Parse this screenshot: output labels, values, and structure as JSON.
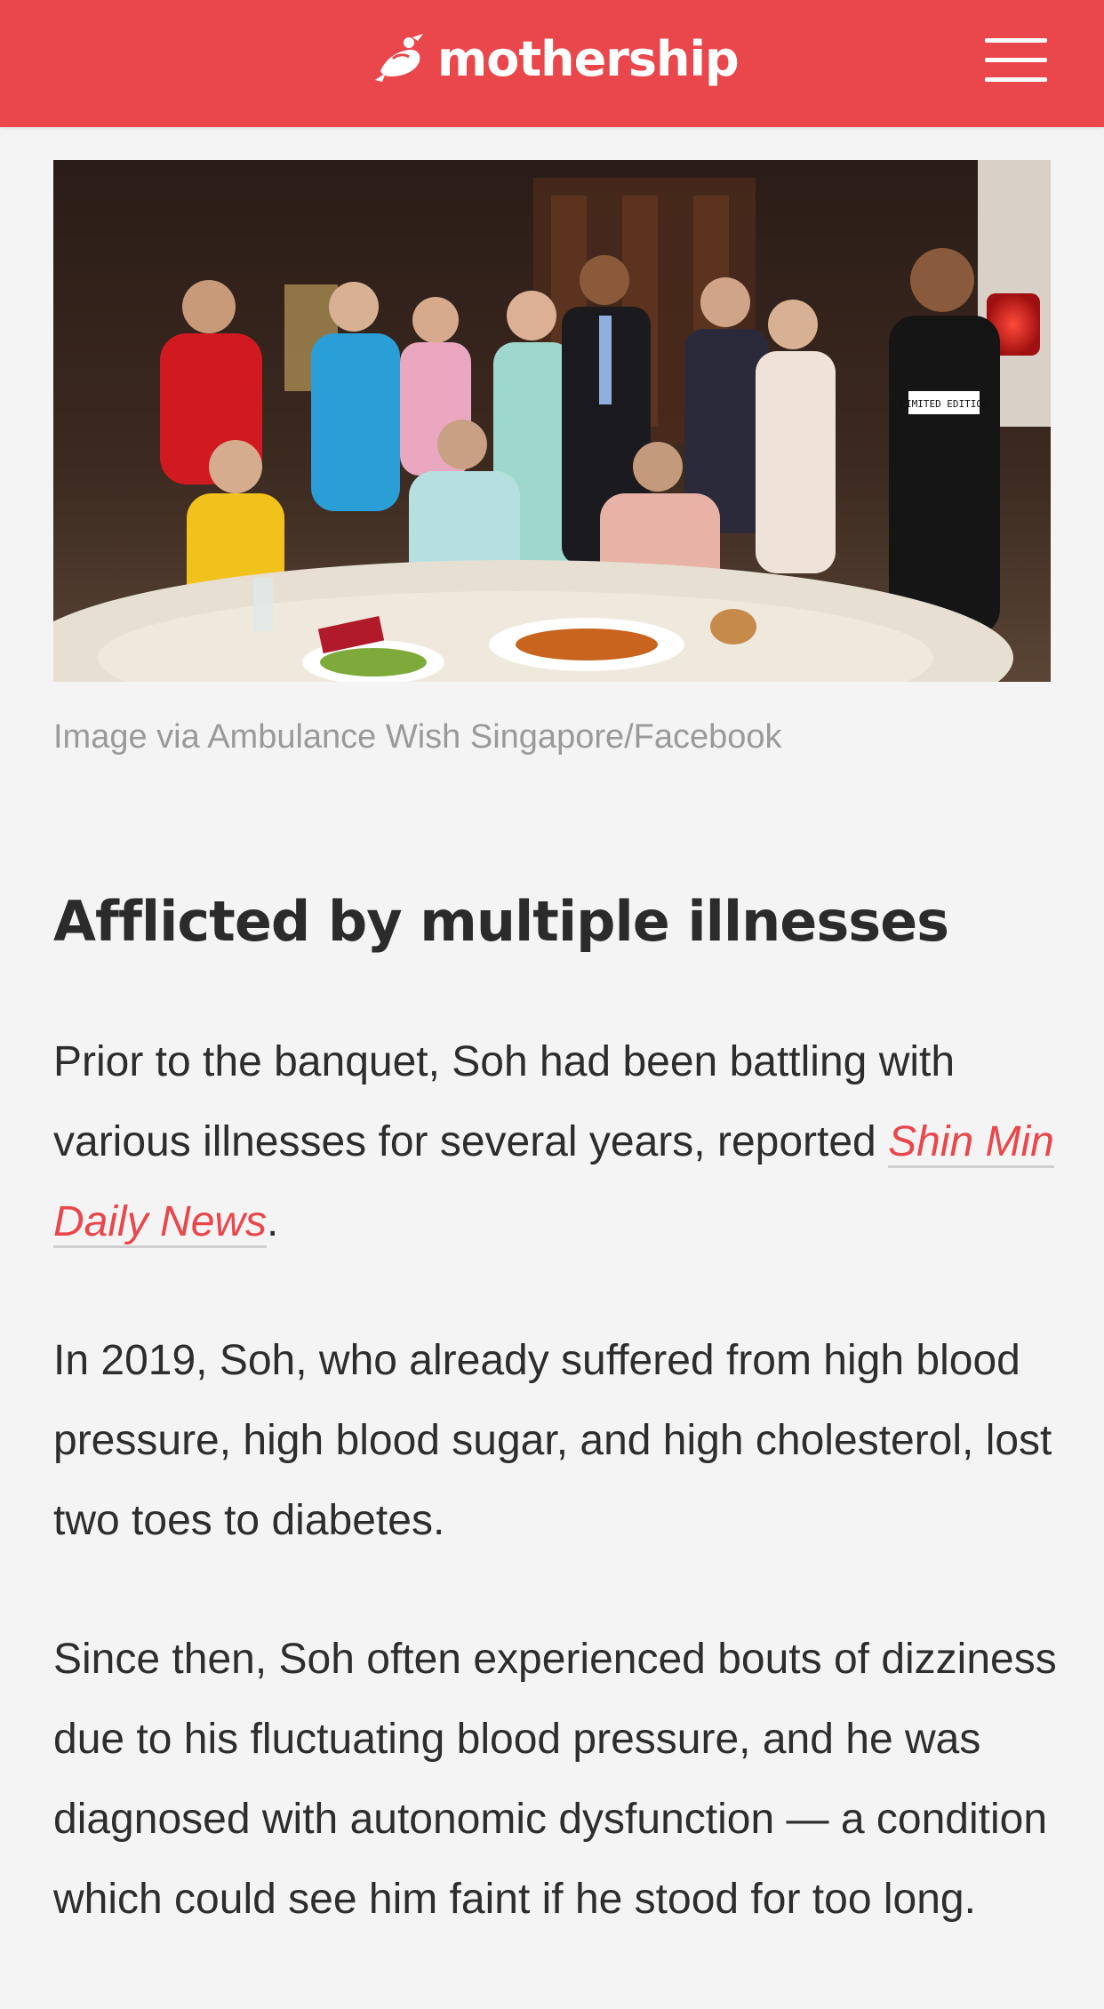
{
  "header": {
    "brand": "mothership",
    "menu_icon": "hamburger-menu-icon",
    "bg_color": "#e9474c"
  },
  "image": {
    "caption": "Image via Ambulance Wish Singapore/Facebook",
    "shirt_text": "LIMITED EDITION"
  },
  "article": {
    "heading": "Afflicted by multiple illnesses",
    "p1_before": "Prior to the banquet, Soh had been battling with various illnesses for several years, reported ",
    "p1_link": "Shin Min Daily News",
    "p1_after": ".",
    "p2": "In 2019, Soh, who already suffered from high blood pressure, high blood sugar, and high cholesterol, lost two toes to diabetes.",
    "p3": "Since then, Soh often experienced bouts of dizziness due to his fluctuating blood pressure, and he was diagnosed with autonomic dysfunction — a condition which could see him faint if he stood for too long.",
    "link_color": "#e9474c"
  }
}
